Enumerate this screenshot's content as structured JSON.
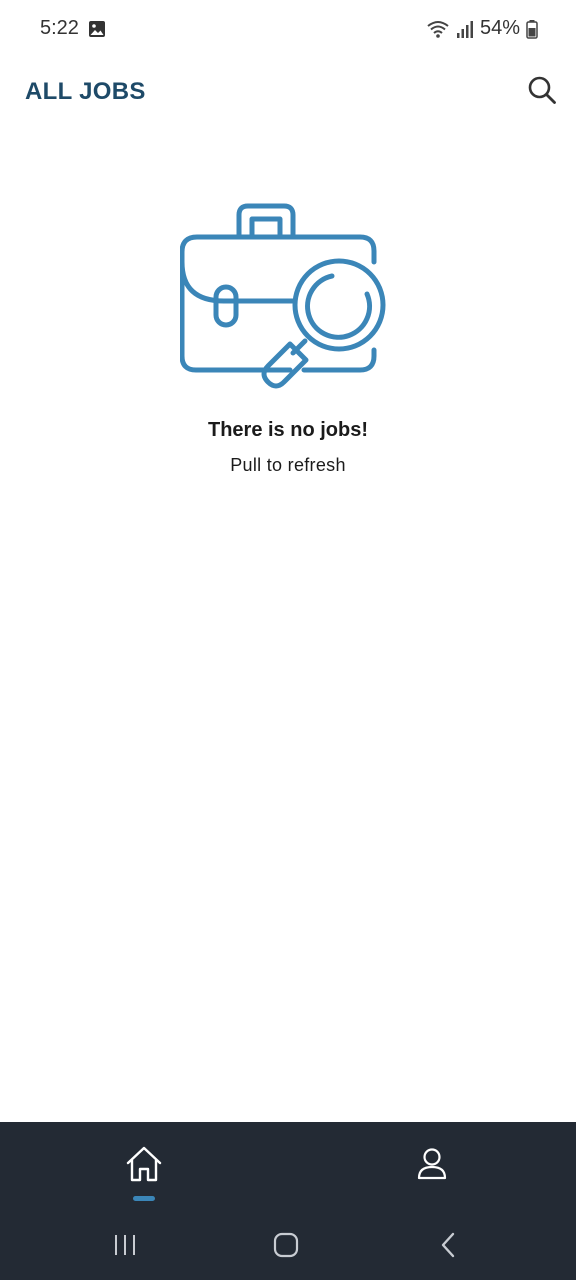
{
  "status_bar": {
    "time": "5:22",
    "battery": "54%"
  },
  "app_bar": {
    "title": "ALL JOBS",
    "search_icon": "search-icon"
  },
  "empty_state": {
    "illustration_icon": "briefcase-search-icon",
    "title": "There is no jobs!",
    "subtitle": "Pull to refresh"
  },
  "bottom_nav": {
    "items": [
      {
        "icon": "home-icon",
        "active": true
      },
      {
        "icon": "user-icon",
        "active": false
      }
    ]
  },
  "colors": {
    "title": "#1e4a68",
    "illustration": "#3b86b8",
    "nav_background": "#232a34",
    "indicator": "#3b86b8"
  }
}
